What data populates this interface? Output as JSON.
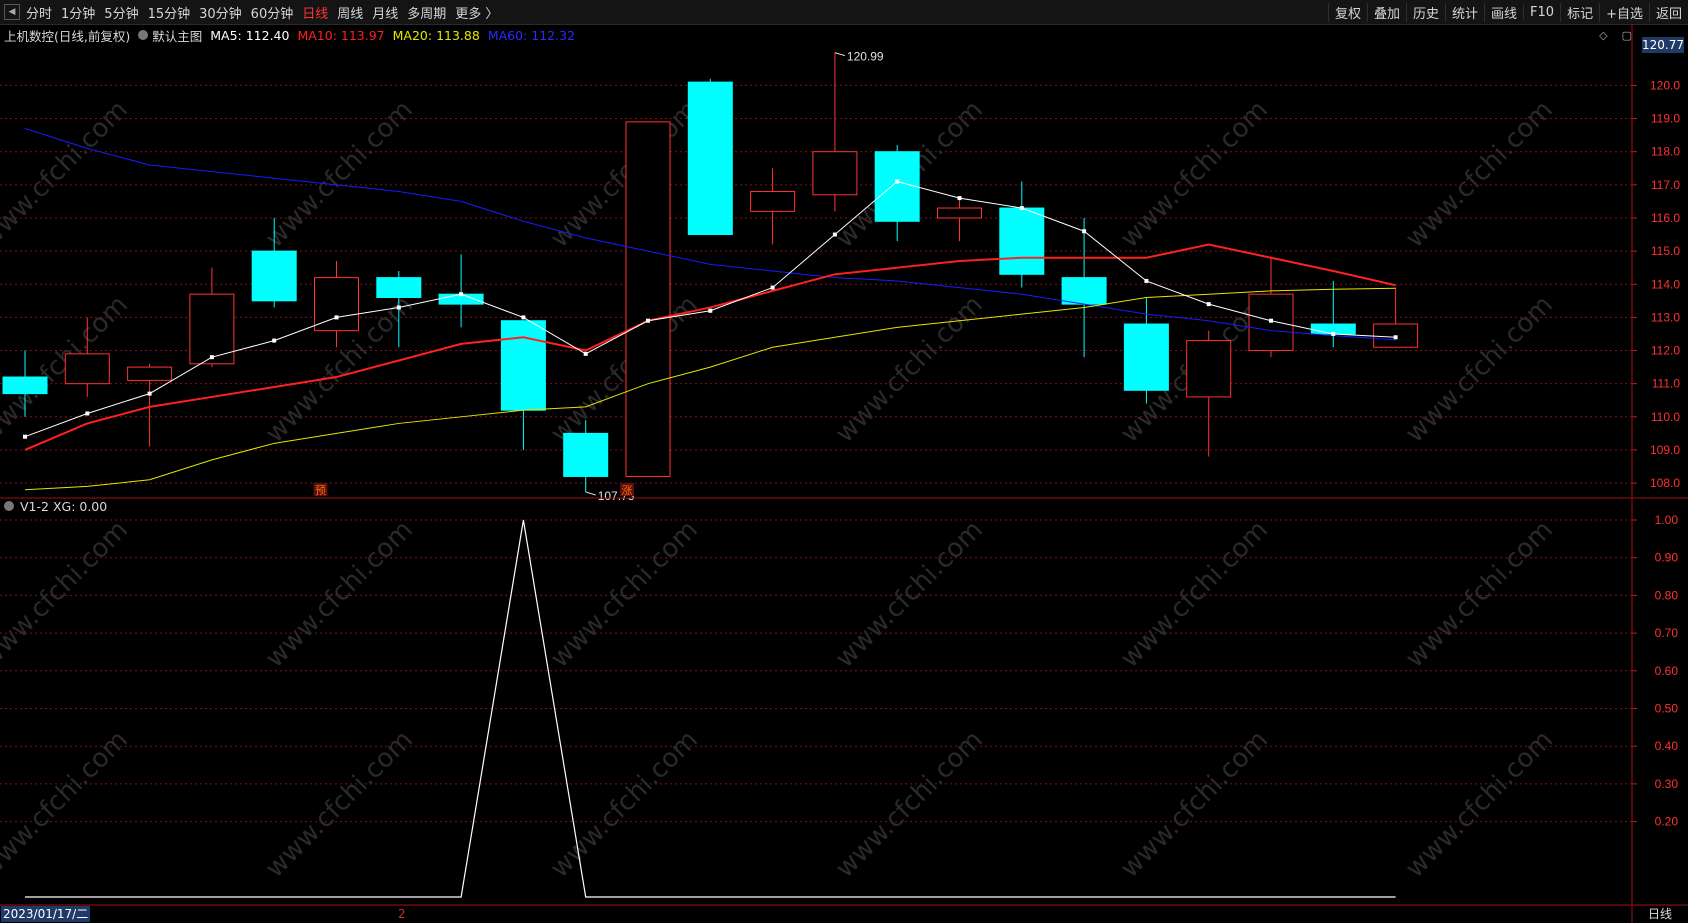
{
  "toolbar": {
    "left": [
      "分时",
      "1分钟",
      "5分钟",
      "15分钟",
      "30分钟",
      "60分钟",
      "日线",
      "周线",
      "月线",
      "多周期",
      "更多 〉"
    ],
    "active": "日线",
    "right": [
      "复权",
      "叠加",
      "历史",
      "统计",
      "画线",
      "F10",
      "标记",
      "+自选",
      "返回"
    ]
  },
  "legend": {
    "stock": "上机数控(日线,前复权)",
    "main": "默认主图",
    "ma5": "MA5: 112.40",
    "ma10": "MA10: 113.97",
    "ma20": "MA20: 113.88",
    "ma60": "MA60: 112.32"
  },
  "indicator_legend": "V1-2  XG: 0.00",
  "current_price_tag": "120.77",
  "date_box": "2023/01/17/二",
  "date_marker": "2",
  "period_label": "日线",
  "markers": {
    "high_label": "120.99",
    "low_label": "107.73",
    "pre_label": "预",
    "rise_label": "涨"
  },
  "colors": {
    "up": "#ff3232",
    "down": "#00ffff",
    "ma5": "#ffffff",
    "ma10": "#ff2020",
    "ma20": "#e5e500",
    "ma60": "#1a1aff",
    "grid": "#8a1010"
  },
  "chart_data": [
    {
      "type": "candlestick",
      "y_ticks": [
        "120.0",
        "119.0",
        "118.0",
        "117.0",
        "116.0",
        "115.0",
        "114.0",
        "113.0",
        "112.0",
        "111.0",
        "110.0",
        "109.0",
        "108.0"
      ],
      "candles": [
        {
          "o": 111.2,
          "c": 110.7,
          "h": 112.0,
          "l": 110.0
        },
        {
          "o": 111.0,
          "c": 111.9,
          "h": 113.0,
          "l": 110.6
        },
        {
          "o": 111.1,
          "c": 111.5,
          "h": 111.6,
          "l": 109.1
        },
        {
          "o": 111.6,
          "c": 113.7,
          "h": 114.5,
          "l": 111.5
        },
        {
          "o": 115.0,
          "c": 113.5,
          "h": 116.0,
          "l": 113.3
        },
        {
          "o": 112.6,
          "c": 114.2,
          "h": 114.7,
          "l": 112.1
        },
        {
          "o": 114.2,
          "c": 113.6,
          "h": 114.4,
          "l": 112.1
        },
        {
          "o": 113.7,
          "c": 113.4,
          "h": 114.9,
          "l": 112.7
        },
        {
          "o": 112.9,
          "c": 110.2,
          "h": 112.9,
          "l": 109.0
        },
        {
          "o": 109.5,
          "c": 108.2,
          "h": 109.9,
          "l": 107.73
        },
        {
          "o": 108.2,
          "c": 118.9,
          "h": 118.9,
          "l": 108.2
        },
        {
          "o": 120.1,
          "c": 115.5,
          "h": 120.2,
          "l": 115.5
        },
        {
          "o": 116.2,
          "c": 116.8,
          "h": 117.5,
          "l": 115.2
        },
        {
          "o": 116.7,
          "c": 118.0,
          "h": 120.99,
          "l": 116.2
        },
        {
          "o": 118.0,
          "c": 115.9,
          "h": 118.2,
          "l": 115.3
        },
        {
          "o": 116.0,
          "c": 116.3,
          "h": 116.6,
          "l": 115.3
        },
        {
          "o": 116.3,
          "c": 114.3,
          "h": 117.1,
          "l": 113.9
        },
        {
          "o": 114.2,
          "c": 113.4,
          "h": 116.0,
          "l": 111.8
        },
        {
          "o": 112.8,
          "c": 110.8,
          "h": 113.6,
          "l": 110.4
        },
        {
          "o": 110.6,
          "c": 112.3,
          "h": 112.6,
          "l": 108.8
        },
        {
          "o": 112.0,
          "c": 113.7,
          "h": 114.8,
          "l": 111.8
        },
        {
          "o": 112.8,
          "c": 112.5,
          "h": 114.1,
          "l": 112.1
        },
        {
          "o": 112.1,
          "c": 112.8,
          "h": 113.9,
          "l": 112.1
        }
      ],
      "series": [
        {
          "name": "MA5",
          "values": [
            109.4,
            110.1,
            110.7,
            111.8,
            112.3,
            113.0,
            113.3,
            113.7,
            113.0,
            111.9,
            112.9,
            113.2,
            113.9,
            115.5,
            117.1,
            116.6,
            116.3,
            115.6,
            114.1,
            113.4,
            112.9,
            112.5,
            112.4
          ]
        },
        {
          "name": "MA10",
          "values": [
            109.0,
            109.8,
            110.3,
            110.6,
            110.9,
            111.2,
            111.7,
            112.2,
            112.4,
            112.0,
            112.9,
            113.3,
            113.8,
            114.3,
            114.5,
            114.7,
            114.8,
            114.8,
            114.8,
            115.2,
            114.8,
            114.4,
            113.97
          ]
        },
        {
          "name": "MA20",
          "values": [
            107.8,
            107.9,
            108.1,
            108.7,
            109.2,
            109.5,
            109.8,
            110.0,
            110.2,
            110.3,
            111.0,
            111.5,
            112.1,
            112.4,
            112.7,
            112.9,
            113.1,
            113.3,
            113.6,
            113.7,
            113.8,
            113.85,
            113.88
          ]
        },
        {
          "name": "MA60",
          "values": [
            118.7,
            118.1,
            117.6,
            117.4,
            117.2,
            117.0,
            116.8,
            116.5,
            115.9,
            115.4,
            115.0,
            114.6,
            114.4,
            114.2,
            114.1,
            113.9,
            113.7,
            113.4,
            113.1,
            112.9,
            112.6,
            112.45,
            112.32
          ]
        }
      ],
      "ylim": [
        107.55,
        121.25
      ]
    },
    {
      "type": "line",
      "y_ticks": [
        "1.00",
        "0.90",
        "0.80",
        "0.70",
        "0.60",
        "0.50",
        "0.40",
        "0.30",
        "0.20"
      ],
      "x": [
        0,
        1,
        2,
        3,
        4,
        5,
        6,
        7,
        8,
        9,
        10,
        11,
        12,
        13,
        14,
        15,
        16,
        17,
        18,
        19,
        20,
        21,
        22
      ],
      "series": [
        {
          "name": "XG",
          "values": [
            0,
            0,
            0,
            0,
            0,
            0,
            0,
            0,
            1,
            0,
            0,
            0,
            0,
            0,
            0,
            0,
            0,
            0,
            0,
            0,
            0,
            0,
            0
          ]
        }
      ],
      "ylim": [
        0,
        1
      ]
    }
  ]
}
